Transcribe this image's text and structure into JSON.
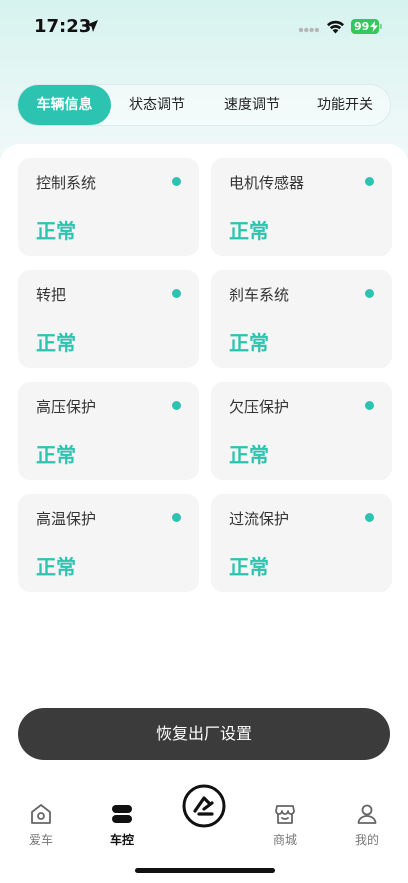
{
  "status_bar": {
    "time": "17:23",
    "battery": "99"
  },
  "tabs": [
    {
      "label": "车辆信息",
      "active": true
    },
    {
      "label": "状态调节",
      "active": false
    },
    {
      "label": "速度调节",
      "active": false
    },
    {
      "label": "功能开关",
      "active": false
    }
  ],
  "cards": [
    {
      "title": "控制系统",
      "status": "正常"
    },
    {
      "title": "电机传感器",
      "status": "正常"
    },
    {
      "title": "转把",
      "status": "正常"
    },
    {
      "title": "刹车系统",
      "status": "正常"
    },
    {
      "title": "高压保护",
      "status": "正常"
    },
    {
      "title": "欠压保护",
      "status": "正常"
    },
    {
      "title": "高温保护",
      "status": "正常"
    },
    {
      "title": "过流保护",
      "status": "正常"
    }
  ],
  "reset_button": "恢复出厂设置",
  "nav": [
    {
      "label": "爱车",
      "icon": "home-icon",
      "active": false
    },
    {
      "label": "车控",
      "icon": "control-icon",
      "active": true
    },
    {
      "label": "",
      "icon": "brand-logo-icon",
      "active": false
    },
    {
      "label": "商城",
      "icon": "store-icon",
      "active": false
    },
    {
      "label": "我的",
      "icon": "profile-icon",
      "active": false
    }
  ],
  "colors": {
    "accent": "#2cc3b1",
    "button_dark": "#3b3b3b",
    "card_bg": "#f5f5f5",
    "battery": "#34c759"
  }
}
